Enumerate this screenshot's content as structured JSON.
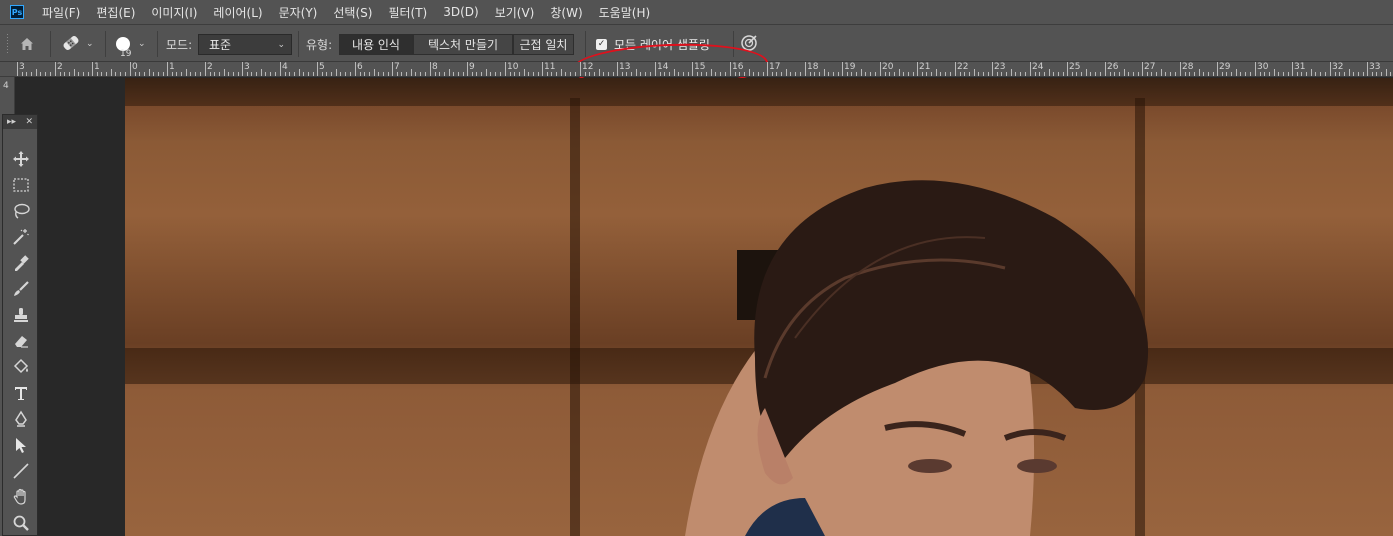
{
  "app": {
    "logo_text": "Ps"
  },
  "menu": [
    "파일(F)",
    "편집(E)",
    "이미지(I)",
    "레이어(L)",
    "문자(Y)",
    "선택(S)",
    "필터(T)",
    "3D(D)",
    "보기(V)",
    "창(W)",
    "도움말(H)"
  ],
  "options": {
    "home_icon": "home-icon",
    "tool_icon": "spot-healing-brush-icon",
    "brush_size": "19",
    "mode_label": "모드:",
    "mode_value": "표준",
    "type_label": "유형:",
    "type_options": [
      "내용 인식",
      "텍스처 만들기",
      "근접 일치"
    ],
    "type_selected": "내용 인식",
    "sample_all_layers": {
      "label": "모든 레이어 샘플링",
      "checked": true
    },
    "pressure_icon": "pressure-size-icon"
  },
  "ruler": {
    "h_labels": [
      "3",
      "2",
      "1",
      "0",
      "1",
      "2",
      "3",
      "4",
      "5",
      "6",
      "7",
      "8",
      "9",
      "10",
      "11",
      "12",
      "13",
      "14",
      "15",
      "16",
      "17",
      "18",
      "19",
      "20",
      "21",
      "22",
      "23",
      "24",
      "25",
      "26",
      "27",
      "28",
      "29",
      "30",
      "31",
      "32",
      "33"
    ],
    "v_label": "4"
  },
  "tools": [
    "move-icon",
    "marquee-icon",
    "lasso-icon",
    "magic-wand-icon",
    "eyedropper-icon",
    "brush-icon",
    "stamp-icon",
    "eraser-icon",
    "paint-bucket-icon",
    "type-icon",
    "pen-icon",
    "path-select-icon",
    "line-icon",
    "hand-icon",
    "zoom-icon"
  ],
  "colors": {
    "chrome": "#535353",
    "workspace": "#282828",
    "highlight": "#e0101c"
  }
}
